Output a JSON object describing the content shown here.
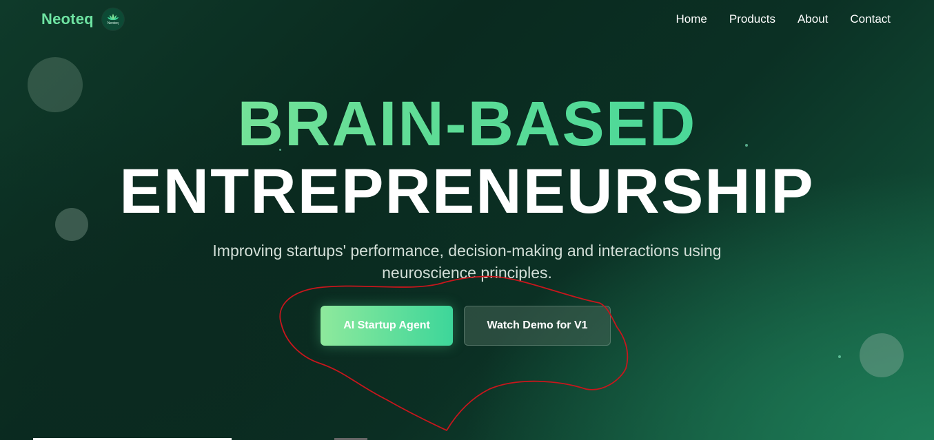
{
  "nav": {
    "brand": "Neoteq",
    "logo_text": "Neoteq",
    "links": [
      "Home",
      "Products",
      "About",
      "Contact"
    ]
  },
  "hero": {
    "line1": "BRAIN-BASED",
    "line2": "ENTREPRENEURSHIP",
    "subtitle": "Improving startups' performance, decision-making and interactions using neuroscience principles."
  },
  "buttons": {
    "primary": "AI Startup Agent",
    "secondary": "Watch Demo for V1"
  },
  "colors": {
    "brand_green": "#6ee3a2",
    "accent_gradient_start": "#8ee99c",
    "accent_gradient_end": "#3dd69a",
    "annotation_red": "#c8161c"
  },
  "icons": {
    "logo": "lotus-icon"
  }
}
